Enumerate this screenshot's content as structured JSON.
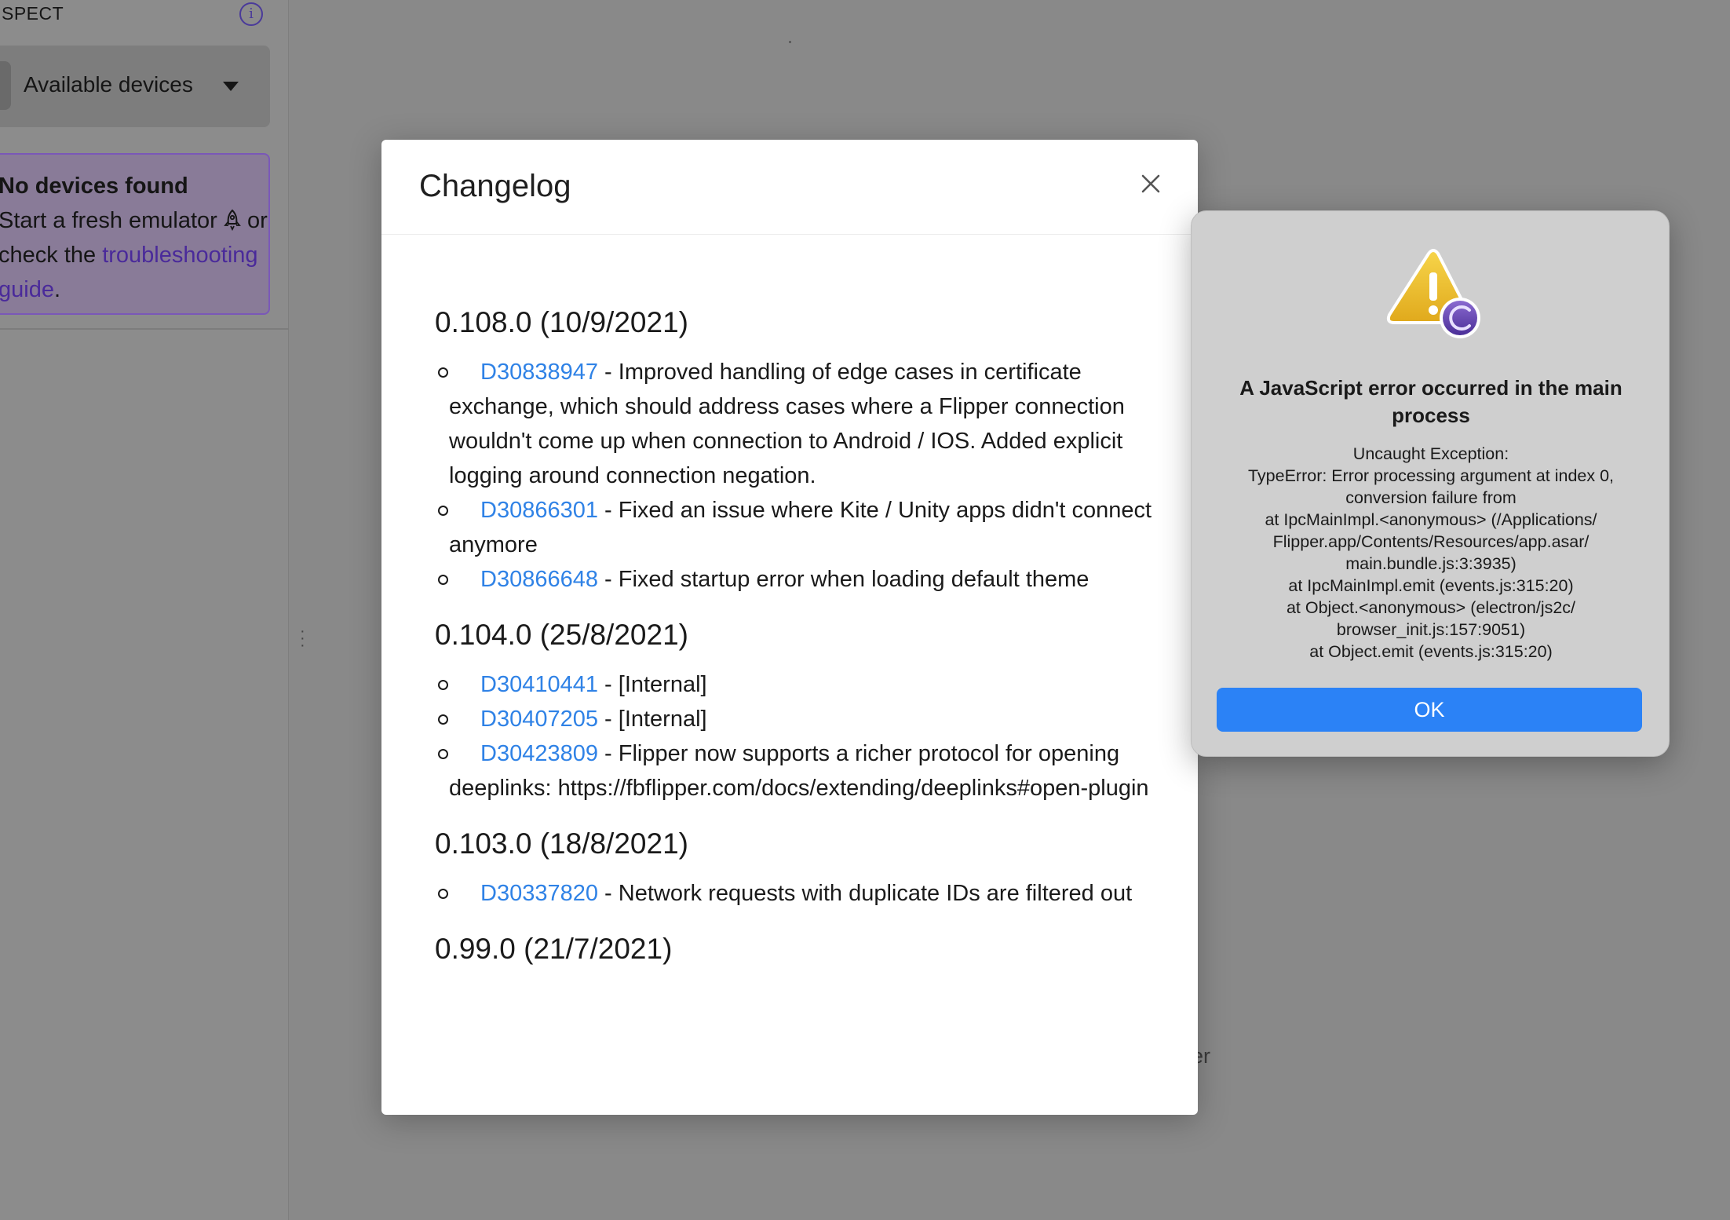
{
  "sidebar": {
    "title": "INSPECT",
    "device_select_label": "Available devices",
    "notice": {
      "title": "No devices found",
      "line1_prefix": "Start a fresh emulator",
      "line1_suffix": "or",
      "line2_prefix": "check the",
      "link": "troubleshooting guide",
      "suffix": "."
    }
  },
  "background_text": "er",
  "changelog": {
    "title": "Changelog",
    "releases": [
      {
        "version": "0.108.0 (10/9/2021)",
        "entries": [
          {
            "id": "D30838947",
            "text": " - Improved handling of edge cases in certificate exchange, which should address cases where a Flipper connection wouldn't come up when connection to Android / IOS. Added explicit logging around connection negation."
          },
          {
            "id": "D30866301",
            "text": " - Fixed an issue where Kite / Unity apps didn't connect anymore"
          },
          {
            "id": "D30866648",
            "text": " - Fixed startup error when loading default theme"
          }
        ]
      },
      {
        "version": "0.104.0 (25/8/2021)",
        "entries": [
          {
            "id": "D30410441",
            "text": " - [Internal]"
          },
          {
            "id": "D30407205",
            "text": " - [Internal]"
          },
          {
            "id": "D30423809",
            "text": " - Flipper now supports a richer protocol for opening deeplinks: https://fbflipper.com/docs/extending/deeplinks#open-plugin"
          }
        ]
      },
      {
        "version": "0.103.0 (18/8/2021)",
        "entries": [
          {
            "id": "D30337820",
            "text": " - Network requests with duplicate IDs are filtered out"
          }
        ]
      },
      {
        "version": "0.99.0 (21/7/2021)",
        "entries": []
      }
    ]
  },
  "error_dialog": {
    "title": "A JavaScript error occurred in the main process",
    "message_lines": [
      "Uncaught Exception:",
      "TypeError: Error processing argument at index 0,",
      "conversion failure from",
      "at IpcMainImpl.<anonymous> (/Applications/",
      "Flipper.app/Contents/Resources/app.asar/",
      "main.bundle.js:3:3935)",
      "at IpcMainImpl.emit (events.js:315:20)",
      "at Object.<anonymous> (electron/js2c/",
      "browser_init.js:157:9051)",
      "at Object.emit (events.js:315:20)"
    ],
    "ok_label": "OK"
  },
  "colors": {
    "link": "#2f82e6",
    "ok_button": "#2b82f6",
    "accent_purple": "#7a58b8"
  }
}
